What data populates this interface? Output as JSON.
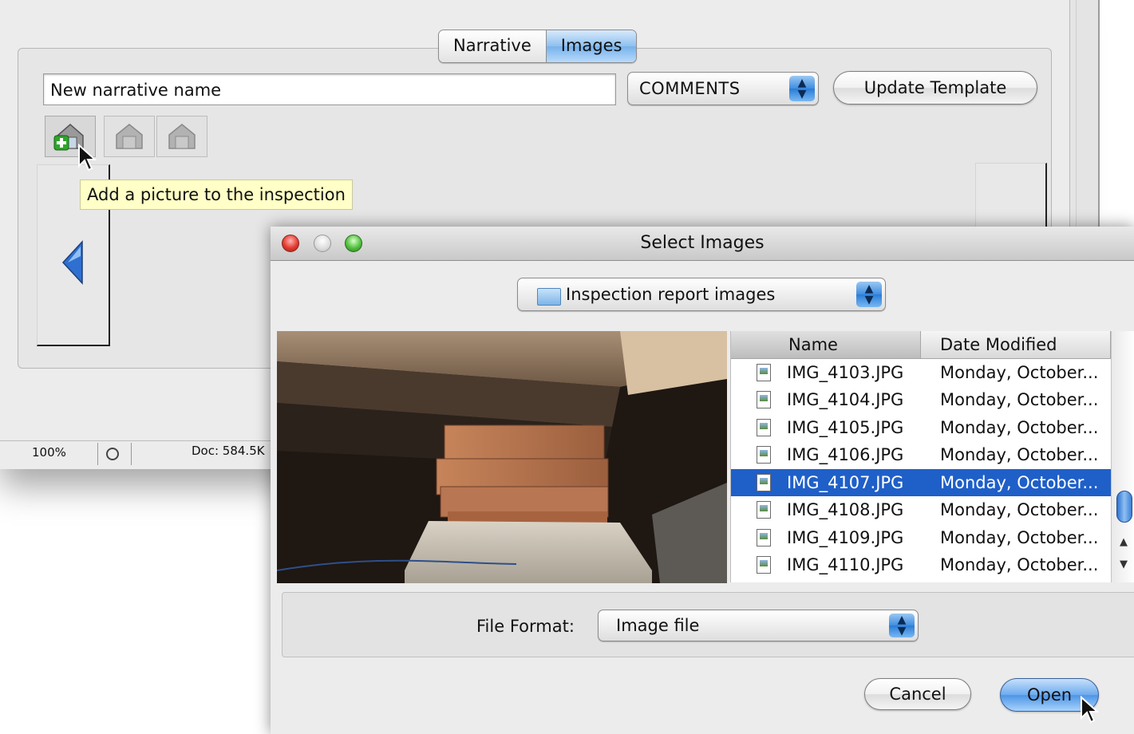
{
  "main_window": {
    "tabs": [
      {
        "label": "Narrative",
        "active": false
      },
      {
        "label": "Images",
        "active": true
      }
    ],
    "name_field_value": "New narrative name",
    "category_select": "COMMENTS",
    "update_template_label": "Update Template",
    "tooltip": "Add a picture to the inspection",
    "status_bar": {
      "zoom": "100%",
      "doc": "Doc: 584.5K"
    }
  },
  "dialog": {
    "title": "Select Images",
    "folder": "Inspection report images",
    "columns": [
      "Name",
      "Date Modified"
    ],
    "files": [
      {
        "name": "IMG_4103.JPG",
        "date": "Monday, October...",
        "selected": false
      },
      {
        "name": "IMG_4104.JPG",
        "date": "Monday, October...",
        "selected": false
      },
      {
        "name": "IMG_4105.JPG",
        "date": "Monday, October...",
        "selected": false
      },
      {
        "name": "IMG_4106.JPG",
        "date": "Monday, October...",
        "selected": false
      },
      {
        "name": "IMG_4107.JPG",
        "date": "Monday, October...",
        "selected": true
      },
      {
        "name": "IMG_4108.JPG",
        "date": "Monday, October...",
        "selected": false
      },
      {
        "name": "IMG_4109.JPG",
        "date": "Monday, October...",
        "selected": false
      },
      {
        "name": "IMG_4110.JPG",
        "date": "Monday, October...",
        "selected": false
      }
    ],
    "file_format_label": "File Format:",
    "file_format_value": "Image file",
    "cancel_label": "Cancel",
    "open_label": "Open"
  },
  "colors": {
    "selection": "#1f5fc8",
    "tooltip_bg": "#ffffc7",
    "aqua_blue": "#4d95e6"
  },
  "icons": [
    "add-picture-icon",
    "picture-icon",
    "previous-arrow-icon",
    "folder-icon",
    "file-icon",
    "mouse-cursor-icon"
  ]
}
